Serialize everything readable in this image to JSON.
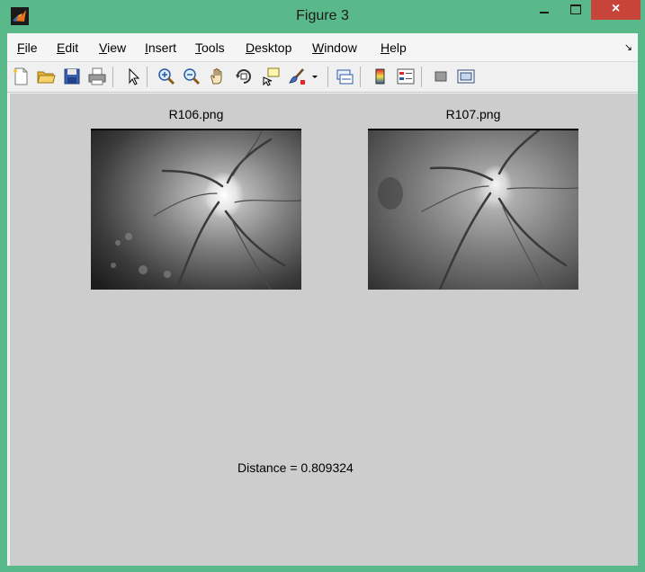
{
  "window": {
    "title": "Figure 3",
    "controls": {
      "minimize": "minimize",
      "maximize": "maximize",
      "close": "×"
    }
  },
  "menubar": {
    "items": [
      {
        "label": "File",
        "underline": "F",
        "rest": "ile"
      },
      {
        "label": "Edit",
        "underline": "E",
        "rest": "dit"
      },
      {
        "label": "View",
        "underline": "V",
        "rest": "iew"
      },
      {
        "label": "Insert",
        "underline": "I",
        "rest": "nsert"
      },
      {
        "label": "Tools",
        "underline": "T",
        "rest": "ools"
      },
      {
        "label": "Desktop",
        "underline": "D",
        "rest": "esktop"
      },
      {
        "label": "Window",
        "underline": "W",
        "rest": "indow"
      },
      {
        "label": "Help",
        "underline": "H",
        "rest": "elp"
      }
    ],
    "dock_arrow": "↘"
  },
  "toolbar": {
    "icons": [
      "new-figure-icon",
      "open-file-icon",
      "save-icon",
      "print-icon",
      "edit-plot-arrow-icon",
      "zoom-in-icon",
      "zoom-out-icon",
      "pan-hand-icon",
      "rotate-3d-icon",
      "data-cursor-icon",
      "brush-icon",
      "brush-dropdown-icon",
      "link-plot-icon",
      "colorbar-icon",
      "legend-icon",
      "hide-plot-tools-icon",
      "show-plot-tools-icon"
    ]
  },
  "figure": {
    "left_image_title": "R106.png",
    "right_image_title": "R107.png",
    "distance_text": "Distance = 0.809324"
  }
}
